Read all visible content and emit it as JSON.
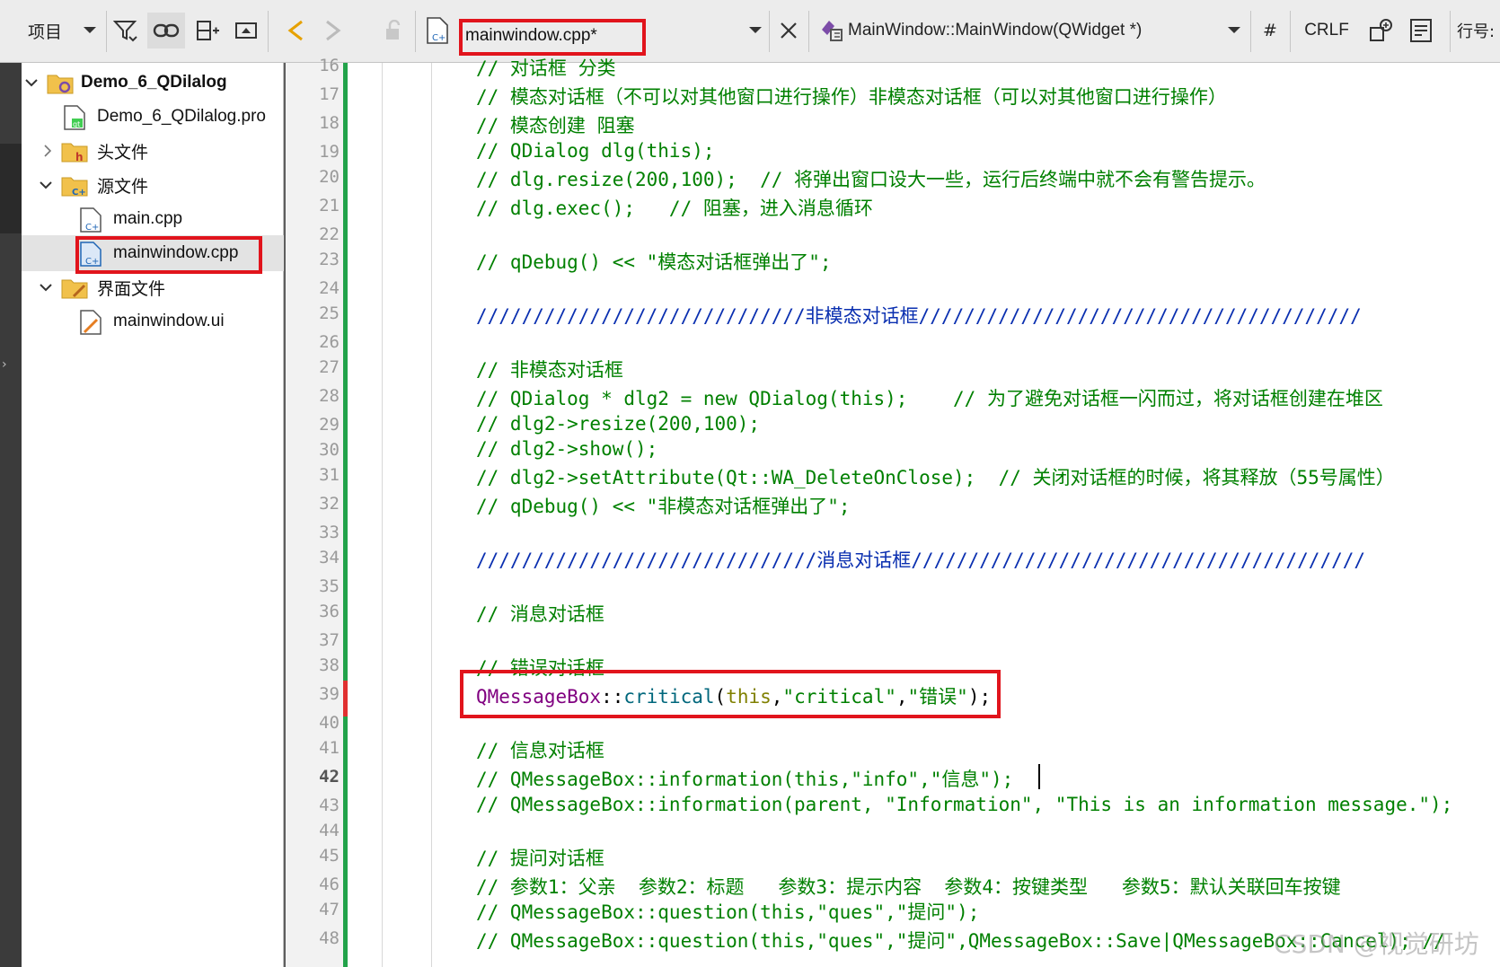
{
  "toolbar": {
    "project_label": "项目",
    "file_name": "mainwindow.cpp*",
    "function_label": "MainWindow::MainWindow(QWidget *)",
    "hash_label": "#",
    "line_ending": "CRLF",
    "line_label": "行号:",
    "icons": [
      "dropdown-icon",
      "filter-icon",
      "link-icon",
      "split-icon",
      "float-icon",
      "back-icon",
      "forward-icon",
      "lock-icon",
      "cpp-file-icon",
      "close-icon",
      "class-icon",
      "bookmark-icon",
      "outline-icon"
    ]
  },
  "tree": {
    "project": "Demo_6_QDilalog",
    "pro_file": "Demo_6_QDilalog.pro",
    "headers_folder": "头文件",
    "sources_folder": "源文件",
    "main_cpp": "main.cpp",
    "mainwindow_cpp": "mainwindow.cpp",
    "forms_folder": "界面文件",
    "mainwindow_ui": "mainwindow.ui"
  },
  "editor": {
    "line_numbers": [
      "16",
      "17",
      "18",
      "19",
      "20",
      "21",
      "22",
      "23",
      "24",
      "25",
      "26",
      "27",
      "28",
      "29",
      "30",
      "31",
      "32",
      "33",
      "34",
      "35",
      "36",
      "37",
      "38",
      "39",
      "40",
      "41",
      "42",
      "43",
      "44",
      "45",
      "46",
      "47",
      "48"
    ],
    "current_line": "42",
    "lines": {
      "l16": "// 对话框 分类",
      "l17": "// 模态对话框（不可以对其他窗口进行操作）非模态对话框（可以对其他窗口进行操作）",
      "l18": "// 模态创建 阻塞",
      "l19": "// QDialog dlg(this);",
      "l20": "// dlg.resize(200,100);  // 将弹出窗口设大一些，运行后终端中就不会有警告提示。",
      "l21": "// dlg.exec();   // 阻塞，进入消息循环",
      "l23": "// qDebug() << \"模态对话框弹出了\";",
      "l25": "/////////////////////////////非模态对话框///////////////////////////////////////",
      "l27": "// 非模态对话框",
      "l28": "// QDialog * dlg2 = new QDialog(this);    // 为了避免对话框一闪而过，将对话框创建在堆区",
      "l29": "// dlg2->resize(200,100);",
      "l30": "// dlg2->show();",
      "l31": "// dlg2->setAttribute(Qt::WA_DeleteOnClose);  // 关闭对话框的时候，将其释放（55号属性）",
      "l32": "// qDebug() << \"非模态对话框弹出了\";",
      "l34": "//////////////////////////////消息对话框////////////////////////////////////////",
      "l36": "// 消息对话框",
      "l38": "// 错误对话框",
      "l39_class": "QMessageBox",
      "l39_sep": "::",
      "l39_fn": "critical",
      "l39_paren_open": "(",
      "l39_kw": "this",
      "l39_comma1": ",",
      "l39_str1": "\"critical\"",
      "l39_comma2": ",",
      "l39_str2": "\"错误\"",
      "l39_end": ");",
      "l41": "// 信息对话框",
      "l42": "// QMessageBox::information(this,\"info\",\"信息\");",
      "l43": "// QMessageBox::information(parent, \"Information\", \"This is an information message.\");",
      "l45": "// 提问对话框",
      "l46": "// 参数1：父亲  参数2：标题   参数3：提示内容  参数4：按键类型   参数5：默认关联回车按键",
      "l47": "// QMessageBox::question(this,\"ques\",\"提问\");",
      "l48": "// QMessageBox::question(this,\"ques\",\"提问\",QMessageBox::Save|QMessageBox::Cancel); //"
    }
  },
  "watermark": "CSDN @视觉研坊",
  "colors": {
    "comment": "#008000",
    "separator_comment": "#0a2fb0",
    "keyword": "#808000",
    "class": "#800080",
    "function": "#00677c",
    "annotation": "#e1141c",
    "changed_bar": "#22a34a"
  }
}
